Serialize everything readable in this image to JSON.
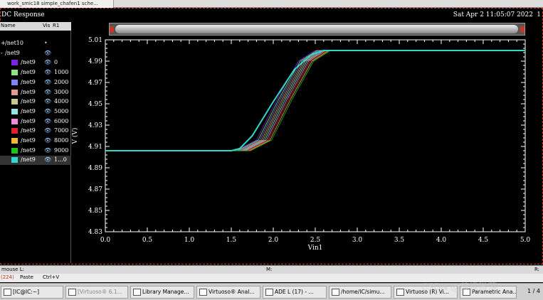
{
  "window": {
    "tab_title": "work_smic18 simple_chafen1 sche..."
  },
  "plot": {
    "title": "DC Response",
    "datetime": "Sat Apr 2 11:05:07 2022",
    "corner": "1"
  },
  "legend": {
    "headers": {
      "name": "Name",
      "vis": "Vis",
      "r": "R1"
    },
    "rows": [
      {
        "expander": "+",
        "name": "/net10",
        "eye": "•",
        "value": "",
        "color": ""
      },
      {
        "expander": "-",
        "name": "/net9",
        "eye": "👁",
        "value": "",
        "color": ""
      },
      {
        "expander": "",
        "name": "/net9",
        "eye": "👁",
        "value": "0",
        "color": "#7a24e0"
      },
      {
        "expander": "",
        "name": "/net9",
        "eye": "👁",
        "value": "1000",
        "color": "#8fe080"
      },
      {
        "expander": "",
        "name": "/net9",
        "eye": "👁",
        "value": "2000",
        "color": "#7f86f0"
      },
      {
        "expander": "",
        "name": "/net9",
        "eye": "👁",
        "value": "3000",
        "color": "#e39a8a"
      },
      {
        "expander": "",
        "name": "/net9",
        "eye": "👁",
        "value": "4000",
        "color": "#c8c88c"
      },
      {
        "expander": "",
        "name": "/net9",
        "eye": "👁",
        "value": "5000",
        "color": "#8fe8e0"
      },
      {
        "expander": "",
        "name": "/net9",
        "eye": "👁",
        "value": "6000",
        "color": "#f08ad8"
      },
      {
        "expander": "",
        "name": "/net9",
        "eye": "👁",
        "value": "7000",
        "color": "#e0202a"
      },
      {
        "expander": "",
        "name": "/net9",
        "eye": "👁",
        "value": "8000",
        "color": "#f0b838"
      },
      {
        "expander": "",
        "name": "/net9",
        "eye": "👁",
        "value": "9000",
        "color": "#22c020"
      },
      {
        "expander": "",
        "name": "/net9",
        "eye": "👁",
        "value": "1...0",
        "color": "#30d8d0"
      }
    ]
  },
  "chart_data": {
    "type": "line",
    "xlabel": "Vin1",
    "ylabel": "V (V)",
    "xlim": [
      0.0,
      5.0
    ],
    "ylim": [
      4.83,
      5.01
    ],
    "xticks": [
      "0.0",
      "0.5",
      "1.0",
      "1.5",
      "2.0",
      "2.5",
      "3.0",
      "3.5",
      "4.0",
      "4.5",
      "5.0"
    ],
    "yticks": [
      "4.83",
      "4.85",
      "4.87",
      "4.89",
      "4.91",
      "4.93",
      "4.95",
      "4.97",
      "4.99",
      "5.01"
    ],
    "series": [
      {
        "name": "0",
        "color": "#7a24e0",
        "x": [
          0,
          1.55,
          1.8,
          2.05,
          2.3,
          2.5,
          5.0
        ],
        "y": [
          4.906,
          4.906,
          4.916,
          4.955,
          4.99,
          5.0,
          5.0
        ]
      },
      {
        "name": "1000",
        "color": "#8fe080",
        "x": [
          0,
          1.57,
          1.82,
          2.07,
          2.32,
          2.52,
          5.0
        ],
        "y": [
          4.906,
          4.906,
          4.916,
          4.955,
          4.99,
          5.0,
          5.0
        ]
      },
      {
        "name": "2000",
        "color": "#7f86f0",
        "x": [
          0,
          1.59,
          1.84,
          2.09,
          2.34,
          2.54,
          5.0
        ],
        "y": [
          4.906,
          4.906,
          4.916,
          4.955,
          4.99,
          5.0,
          5.0
        ]
      },
      {
        "name": "3000",
        "color": "#e39a8a",
        "x": [
          0,
          1.61,
          1.86,
          2.11,
          2.36,
          2.56,
          5.0
        ],
        "y": [
          4.906,
          4.906,
          4.916,
          4.955,
          4.99,
          5.0,
          5.0
        ]
      },
      {
        "name": "4000",
        "color": "#c8c88c",
        "x": [
          0,
          1.63,
          1.88,
          2.13,
          2.38,
          2.58,
          5.0
        ],
        "y": [
          4.906,
          4.906,
          4.916,
          4.955,
          4.99,
          5.0,
          5.0
        ]
      },
      {
        "name": "5000",
        "color": "#8fe8e0",
        "x": [
          0,
          1.65,
          1.9,
          2.15,
          2.4,
          2.6,
          5.0
        ],
        "y": [
          4.906,
          4.906,
          4.916,
          4.955,
          4.99,
          5.0,
          5.0
        ]
      },
      {
        "name": "6000",
        "color": "#f08ad8",
        "x": [
          0,
          1.67,
          1.92,
          2.17,
          2.42,
          2.62,
          5.0
        ],
        "y": [
          4.906,
          4.906,
          4.916,
          4.955,
          4.99,
          5.0,
          5.0
        ]
      },
      {
        "name": "7000",
        "color": "#e0202a",
        "x": [
          0,
          1.69,
          1.94,
          2.19,
          2.44,
          2.64,
          5.0
        ],
        "y": [
          4.906,
          4.906,
          4.916,
          4.955,
          4.99,
          5.0,
          5.0
        ]
      },
      {
        "name": "8000",
        "color": "#f0b838",
        "x": [
          0,
          1.71,
          1.96,
          2.21,
          2.46,
          2.66,
          5.0
        ],
        "y": [
          4.906,
          4.906,
          4.916,
          4.955,
          4.99,
          5.0,
          5.0
        ]
      },
      {
        "name": "9000",
        "color": "#22c020",
        "x": [
          0,
          1.73,
          1.98,
          2.23,
          2.48,
          2.68,
          5.0
        ],
        "y": [
          4.906,
          4.906,
          4.916,
          4.955,
          4.99,
          5.0,
          5.0
        ]
      },
      {
        "name": "1...0",
        "color": "#30d8d0",
        "x": [
          0,
          1.5,
          1.6,
          1.75,
          2.0,
          2.25,
          2.45,
          2.6,
          5.0
        ],
        "y": [
          4.906,
          4.906,
          4.908,
          4.92,
          4.952,
          4.982,
          4.996,
          5.0,
          5.0
        ]
      }
    ],
    "grid": false,
    "legend": "left-pane"
  },
  "statusbar": {
    "left": "mouse L:",
    "mid": "M:",
    "right": "R:"
  },
  "cmdbar": {
    "count": "(224)",
    "action": "Paste",
    "shortcut": "Ctrl+V"
  },
  "taskbar": {
    "items": [
      {
        "label": "[IC@IC:~]",
        "icon": "terminal-icon",
        "dim": false
      },
      {
        "label": "[Virtuoso® 6.1...",
        "icon": "virtuoso-icon",
        "dim": true
      },
      {
        "label": "Library Manage...",
        "icon": "library-icon",
        "dim": false
      },
      {
        "label": "Virtuoso® Anal...",
        "icon": "virtuoso-icon",
        "dim": false
      },
      {
        "label": "ADE L (17) - ...",
        "icon": "ade-icon",
        "dim": false
      },
      {
        "label": "/home/IC/simu...",
        "icon": "cadence-icon",
        "dim": false
      },
      {
        "label": "Virtuoso (R) Vi...",
        "icon": "virtuoso-icon",
        "dim": false
      },
      {
        "label": "Parametric Ana...",
        "icon": "parametric-icon",
        "dim": false
      }
    ],
    "pager": "1 / 4"
  },
  "watermark": "CSDN @茶枫微落"
}
